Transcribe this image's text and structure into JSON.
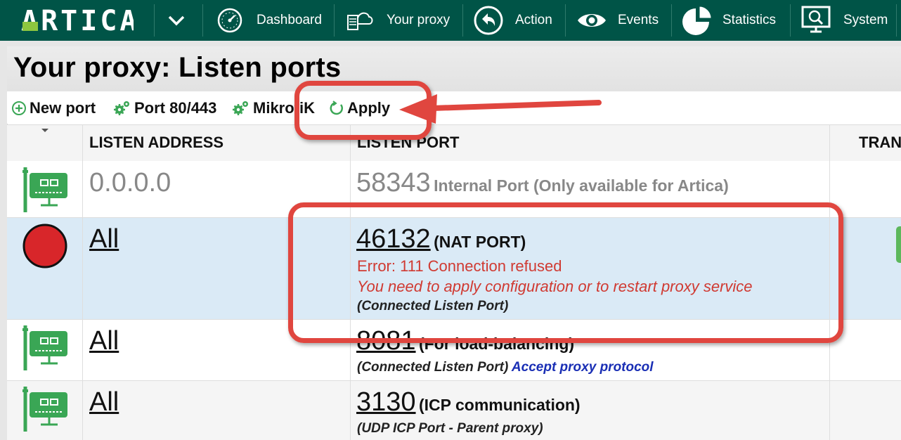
{
  "app": {
    "logo_text": "ARTICA",
    "brand_color": "#005447",
    "accent_green": "#3aa655"
  },
  "nav": {
    "items": [
      {
        "label": "Dashboard",
        "icon": "dashboard-gauge-icon"
      },
      {
        "label": "Your proxy",
        "icon": "proxy-server-icon"
      },
      {
        "label": "Action",
        "icon": "action-back-arrow-icon"
      },
      {
        "label": "Events",
        "icon": "eye-icon"
      },
      {
        "label": "Statistics",
        "icon": "pie-chart-icon"
      },
      {
        "label": "System",
        "icon": "system-monitor-icon"
      }
    ]
  },
  "page": {
    "title": "Your proxy: Listen ports"
  },
  "toolbar": {
    "new_port": "New port",
    "port_80_443": "Port 80/443",
    "mikrotik": "MikrotiK",
    "apply": "Apply"
  },
  "table": {
    "headers": {
      "listen_address": "LISTEN ADDRESS",
      "listen_port": "LISTEN PORT",
      "transparent": "TRAN"
    },
    "rows": [
      {
        "status_icon": "network-card-icon",
        "address": "0.0.0.0",
        "port": "58343",
        "port_label": "Internal Port (Only available for Artica)"
      },
      {
        "status_icon": "red-status-circle-icon",
        "address": "All",
        "port": "46132",
        "port_label": "(NAT PORT)",
        "error": "Error: 111 Connection refused",
        "warning": "You need to apply configuration or to restart proxy service",
        "note": "(Connected Listen Port)"
      },
      {
        "status_icon": "network-card-icon",
        "address": "All",
        "port": "8081",
        "port_label": "(For load-balancing)",
        "note": "(Connected Listen Port)",
        "link": "Accept proxy protocol"
      },
      {
        "status_icon": "network-card-icon",
        "address": "All",
        "port": "3130",
        "port_label": "(ICP communication)",
        "note": "(UDP ICP Port - Parent proxy)"
      }
    ]
  },
  "annotation_color": "#e0463f",
  "error_color": "#d03a32"
}
